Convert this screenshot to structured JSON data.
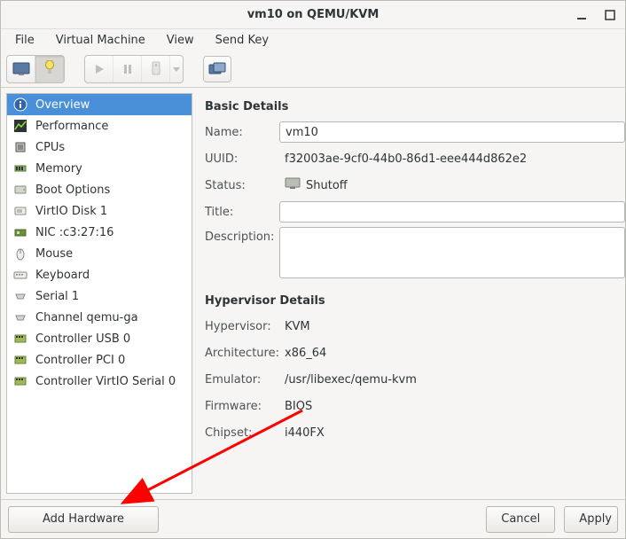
{
  "window": {
    "title": "vm10 on QEMU/KVM"
  },
  "menubar": {
    "items": [
      "File",
      "Virtual Machine",
      "View",
      "Send Key"
    ]
  },
  "sidebar": {
    "selected_index": 0,
    "items": [
      {
        "label": "Overview",
        "icon": "info-icon"
      },
      {
        "label": "Performance",
        "icon": "perf-icon"
      },
      {
        "label": "CPUs",
        "icon": "cpu-icon"
      },
      {
        "label": "Memory",
        "icon": "memory-icon"
      },
      {
        "label": "Boot Options",
        "icon": "boot-icon"
      },
      {
        "label": "VirtIO Disk 1",
        "icon": "disk-icon"
      },
      {
        "label": "NIC :c3:27:16",
        "icon": "nic-icon"
      },
      {
        "label": "Mouse",
        "icon": "mouse-icon"
      },
      {
        "label": "Keyboard",
        "icon": "keyboard-icon"
      },
      {
        "label": "Serial 1",
        "icon": "serial-icon"
      },
      {
        "label": "Channel qemu-ga",
        "icon": "channel-icon"
      },
      {
        "label": "Controller USB 0",
        "icon": "controller-icon"
      },
      {
        "label": "Controller PCI 0",
        "icon": "controller-icon"
      },
      {
        "label": "Controller VirtIO Serial 0",
        "icon": "controller-icon"
      }
    ]
  },
  "details": {
    "basic": {
      "heading": "Basic Details",
      "labels": {
        "name": "Name:",
        "uuid": "UUID:",
        "status": "Status:",
        "title": "Title:",
        "description": "Description:"
      },
      "name": "vm10",
      "uuid": "f32003ae-9cf0-44b0-86d1-eee444d862e2",
      "status": "Shutoff",
      "title": "",
      "description": ""
    },
    "hypervisor": {
      "heading": "Hypervisor Details",
      "labels": {
        "hypervisor": "Hypervisor:",
        "architecture": "Architecture:",
        "emulator": "Emulator:",
        "firmware": "Firmware:",
        "chipset": "Chipset:"
      },
      "hypervisor": "KVM",
      "architecture": "x86_64",
      "emulator": "/usr/libexec/qemu-kvm",
      "firmware": "BIOS",
      "chipset": "i440FX"
    }
  },
  "footer": {
    "add_hardware": "Add Hardware",
    "cancel": "Cancel",
    "apply": "Apply"
  },
  "annotation": {
    "arrow_color": "#ff0000"
  }
}
